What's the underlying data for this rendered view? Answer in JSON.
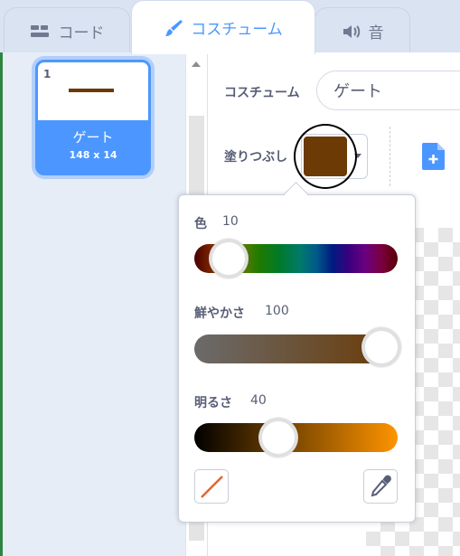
{
  "tabs": [
    {
      "label": "コード",
      "icon": "code-icon"
    },
    {
      "label": "コスチューム",
      "icon": "paintbrush-icon"
    },
    {
      "label": "音",
      "icon": "speaker-icon"
    }
  ],
  "costume_list": {
    "items": [
      {
        "number": "1",
        "name": "ゲート",
        "size": "148 x 14"
      }
    ]
  },
  "editor": {
    "costume_label": "コスチューム",
    "costume_name": "ゲート",
    "fill_label": "塗りつぶし"
  },
  "color_picker": {
    "hue_label": "色",
    "hue_value": "10",
    "saturation_label": "鮮やかさ",
    "saturation_value": "100",
    "brightness_label": "明るさ",
    "brightness_value": "40"
  },
  "colors": {
    "accent": "#4c97ff",
    "fill_color": "#6b3a05",
    "text": "#575e75"
  }
}
